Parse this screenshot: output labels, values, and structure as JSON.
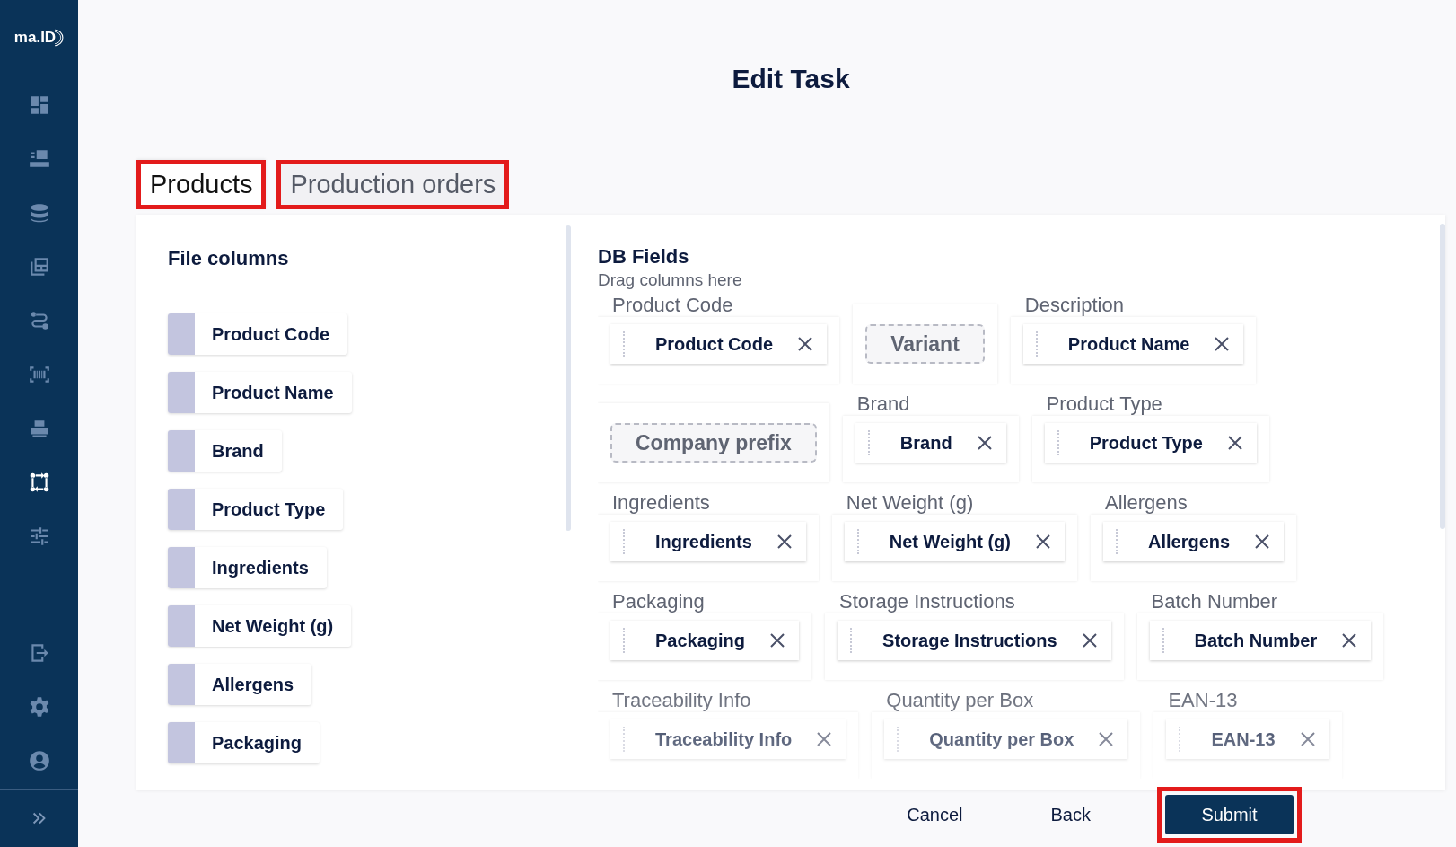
{
  "sidebar": {
    "logo": "ma.ID",
    "items": [
      {
        "selected": false
      },
      {
        "selected": false
      },
      {
        "selected": false
      },
      {
        "selected": false
      },
      {
        "selected": false
      },
      {
        "selected": false
      },
      {
        "selected": false
      },
      {
        "selected": true
      },
      {
        "selected": false
      }
    ]
  },
  "title": "Edit Task",
  "tabs": [
    {
      "label": "Products",
      "selected": true,
      "highlighted": true
    },
    {
      "label": "Production orders",
      "selected": false,
      "highlighted": true
    }
  ],
  "file_columns": {
    "heading": "File columns",
    "items": [
      "Product Code",
      "Product Name",
      "Brand",
      "Product Type",
      "Ingredients",
      "Net Weight (g)",
      "Allergens",
      "Packaging"
    ]
  },
  "db_fields": {
    "heading": "DB Fields",
    "hint": "Drag columns here",
    "rows": [
      [
        {
          "label": "Product Code",
          "kind": "mapped",
          "value": "Product Code"
        },
        {
          "kind": "empty",
          "value": "Variant"
        },
        {
          "label": "Description",
          "kind": "mapped",
          "value": "Product Name"
        }
      ],
      [
        {
          "kind": "empty",
          "value": "Company prefix"
        },
        {
          "label": "Brand",
          "kind": "mapped",
          "value": "Brand"
        },
        {
          "label": "Product Type",
          "kind": "mapped",
          "value": "Product Type"
        }
      ],
      [
        {
          "label": "Ingredients",
          "kind": "mapped",
          "value": "Ingredients"
        },
        {
          "label": "Net Weight (g)",
          "kind": "mapped",
          "value": "Net Weight (g)"
        },
        {
          "label": "Allergens",
          "kind": "mapped",
          "value": "Allergens"
        }
      ],
      [
        {
          "label": "Packaging",
          "kind": "mapped",
          "value": "Packaging"
        },
        {
          "label": "Storage Instructions",
          "kind": "mapped",
          "value": "Storage Instructions"
        },
        {
          "label": "Batch Number",
          "kind": "mapped",
          "value": "Batch Number"
        }
      ],
      [
        {
          "label": "Traceability Info",
          "kind": "mapped",
          "value": "Traceability Info"
        },
        {
          "label": "Quantity per Box",
          "kind": "mapped",
          "value": "Quantity per Box"
        },
        {
          "label": "EAN-13",
          "kind": "mapped",
          "value": "EAN-13"
        }
      ]
    ]
  },
  "buttons": [
    {
      "label": "Cancel",
      "kind": "text"
    },
    {
      "label": "Back",
      "kind": "text"
    },
    {
      "label": "Submit",
      "kind": "primary",
      "highlighted": true
    }
  ]
}
